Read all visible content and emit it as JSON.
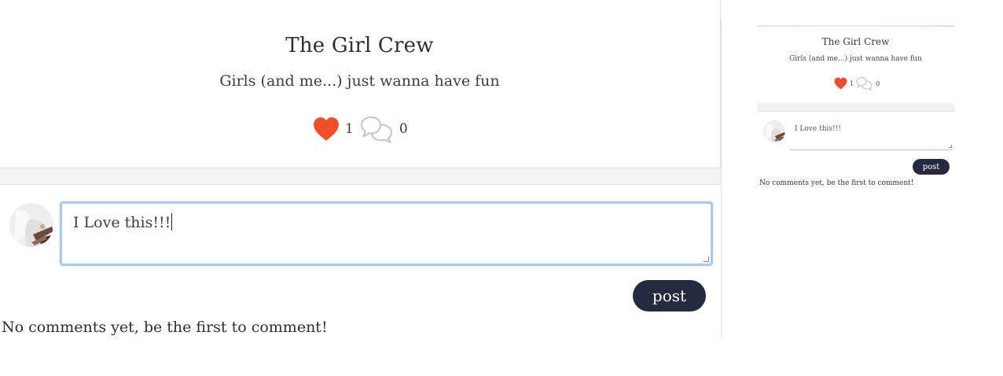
{
  "post": {
    "title": "The Girl Crew",
    "subtitle": "Girls (and me...) just wanna have fun",
    "likes": "1",
    "comments": "0"
  },
  "comment_form": {
    "value": "I Love this!!!",
    "submit_label": "post"
  },
  "empty_state": "No comments yet, be the first to comment!",
  "colors": {
    "heart": "#ef4e2b",
    "button": "#252a40",
    "focus_border": "#a9c9f1"
  },
  "icons": [
    "heart-icon",
    "comment-bubbles-icon"
  ]
}
